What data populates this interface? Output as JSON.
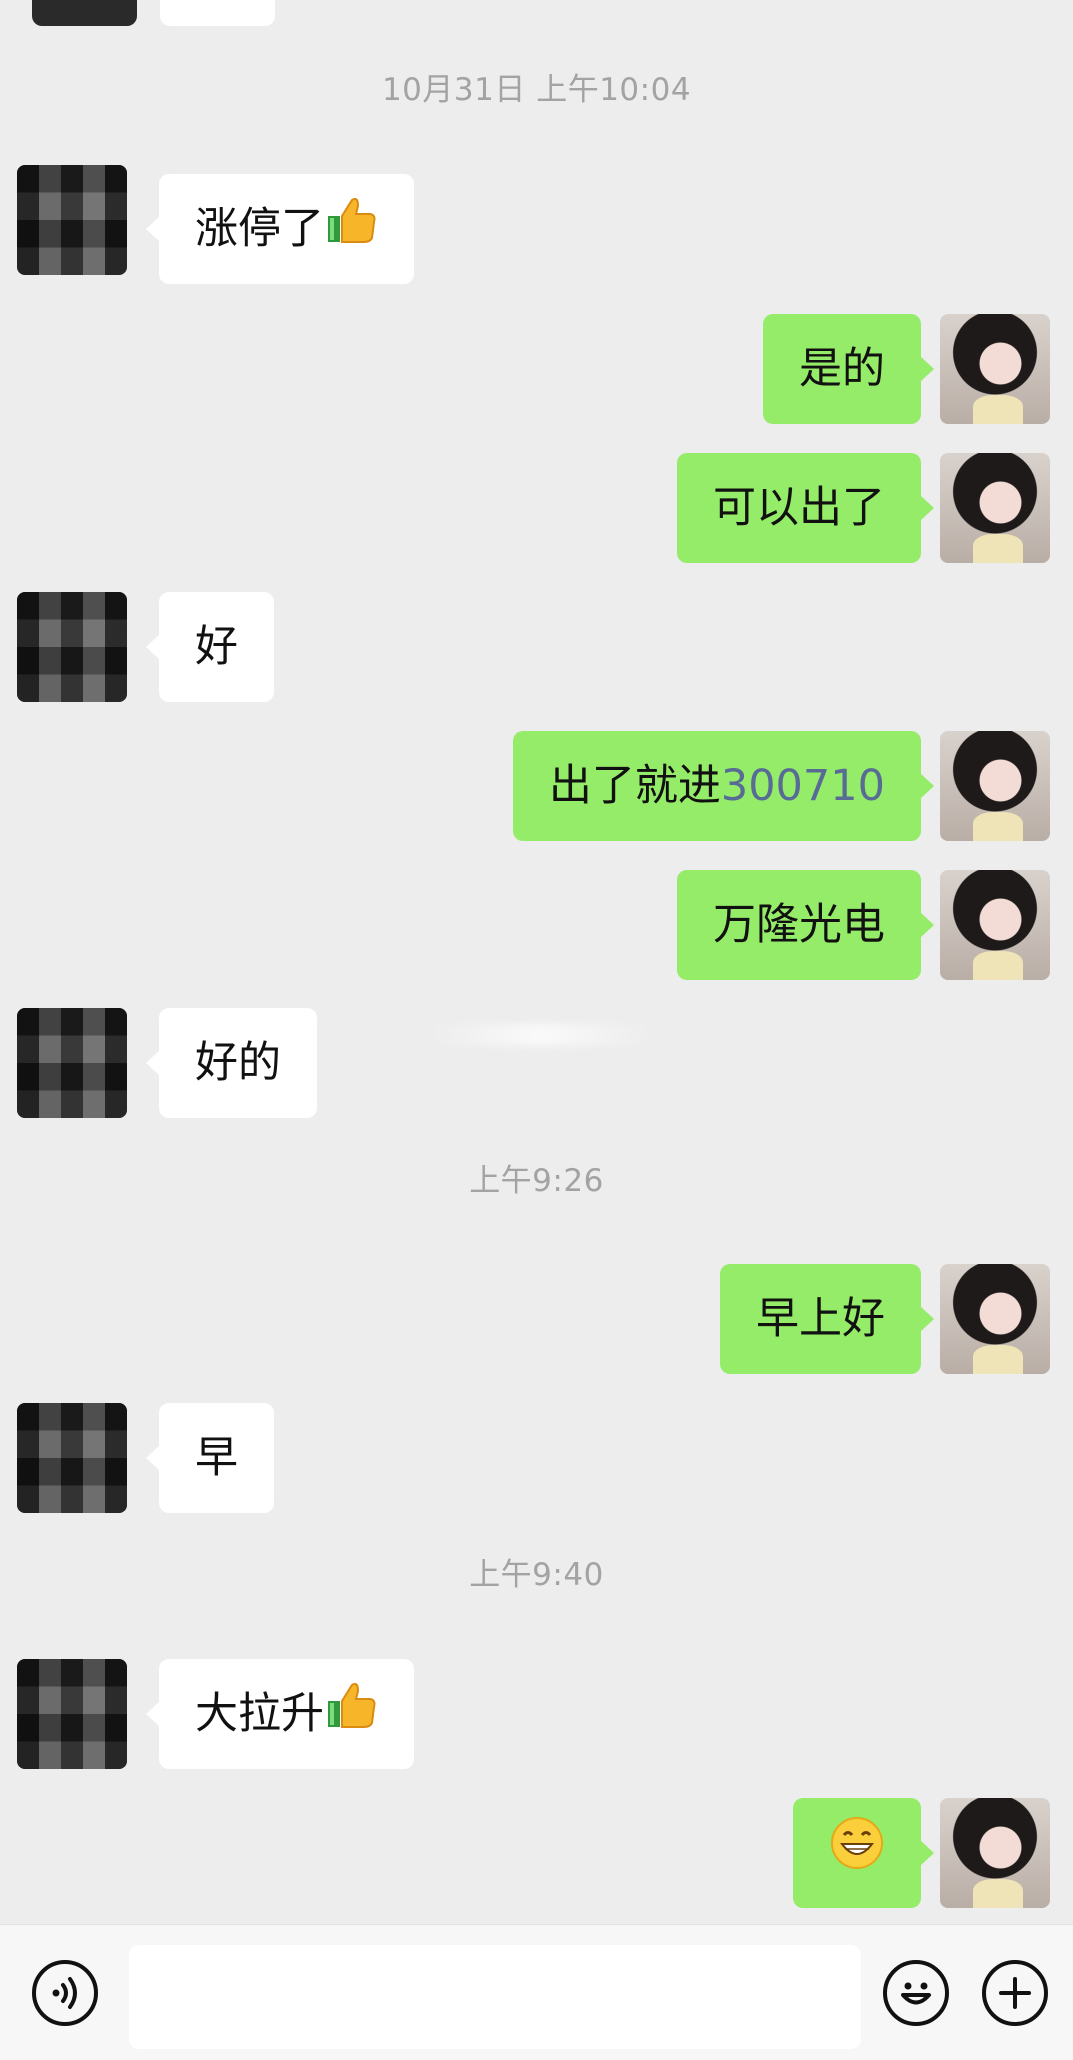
{
  "chat": {
    "timestamps": [
      "10月31日 上午10:04",
      "上午9:26",
      "上午9:40"
    ],
    "messages": {
      "m1": {
        "text": "涨停了",
        "emoji": "thumbs-up"
      },
      "m2": {
        "text": "是的"
      },
      "m3": {
        "text": "可以出了"
      },
      "m4": {
        "text": "好"
      },
      "m5": {
        "text_prefix": "出了就进",
        "stock_code": "300710"
      },
      "m6": {
        "text": "万隆光电"
      },
      "m7": {
        "text": "好的"
      },
      "m8": {
        "text": "早上好"
      },
      "m9": {
        "text": "早"
      },
      "m10": {
        "text": "大拉升",
        "emoji": "thumbs-up"
      },
      "m11": {
        "emoji": "grinning-face"
      }
    }
  },
  "input_bar": {
    "voice_icon": "voice-icon",
    "emoji_icon": "emoji-icon",
    "plus_icon": "plus-icon",
    "input_value": ""
  },
  "colors": {
    "background": "#ededed",
    "outgoing_bubble": "#95ec69",
    "incoming_bubble": "#ffffff",
    "timestamp": "#a3a3a3",
    "link": "#576b95"
  }
}
